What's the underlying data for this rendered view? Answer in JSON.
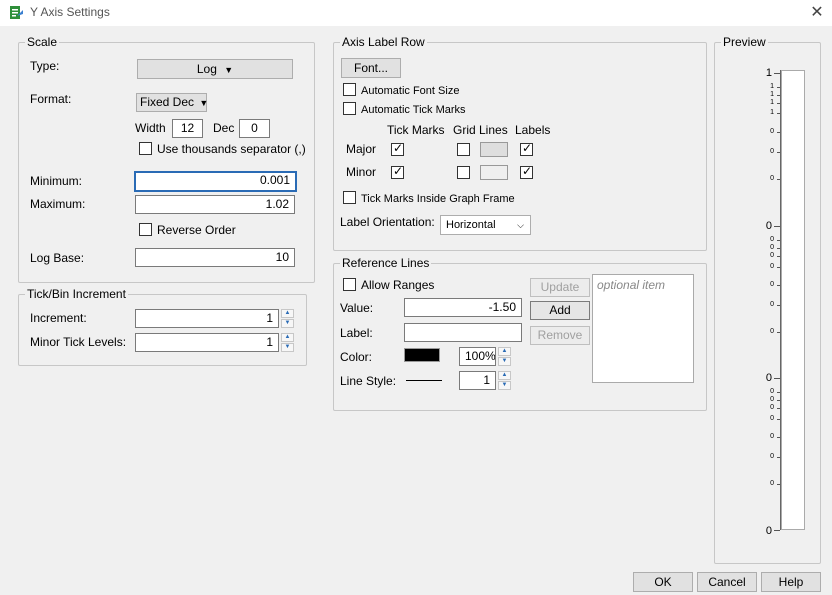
{
  "window": {
    "title": "Y Axis Settings"
  },
  "scale": {
    "legend": "Scale",
    "type_label": "Type:",
    "type_value": "Log",
    "format_label": "Format:",
    "format_value": "Fixed Dec",
    "width_label": "Width",
    "width_value": "12",
    "dec_label": "Dec",
    "dec_value": "0",
    "thousands_label": "Use thousands separator (,)",
    "thousands_checked": false,
    "minimum_label": "Minimum:",
    "minimum_value": "0.001",
    "maximum_label": "Maximum:",
    "maximum_value": "1.02",
    "reverse_label": "Reverse Order",
    "reverse_checked": false,
    "logbase_label": "Log Base:",
    "logbase_value": "10"
  },
  "tick": {
    "legend": "Tick/Bin Increment",
    "increment_label": "Increment:",
    "increment_value": "1",
    "minor_label": "Minor Tick Levels:",
    "minor_value": "1"
  },
  "axis_label_row": {
    "legend": "Axis Label Row",
    "font_button": "Font...",
    "auto_font_label": "Automatic Font Size",
    "auto_tick_label": "Automatic Tick Marks",
    "col_tick": "Tick Marks",
    "col_grid": "Grid Lines",
    "col_labels": "Labels",
    "major_label": "Major",
    "minor_label": "Minor",
    "inside_label": "Tick Marks Inside Graph Frame",
    "orientation_label": "Label Orientation:",
    "orientation_value": "Horizontal",
    "check_mark": "✓"
  },
  "reference_lines": {
    "legend": "Reference Lines",
    "allow_ranges_label": "Allow Ranges",
    "value_label": "Value:",
    "value_value": "-1.50",
    "label_label": "Label:",
    "label_value": "",
    "color_label": "Color:",
    "color_hex": "#000000",
    "opacity_value": "100%",
    "linestyle_label": "Line Style:",
    "linewidth_value": "1",
    "update_button": "Update",
    "add_button": "Add",
    "remove_button": "Remove",
    "list_placeholder": "optional item"
  },
  "preview": {
    "legend": "Preview",
    "top_label": "1",
    "upper_labels": [
      "1",
      "1",
      "1",
      "1",
      "0",
      "0",
      "0"
    ],
    "mid_label": "0",
    "mid_labels": [
      "0",
      "0",
      "0",
      "0",
      "0",
      "0",
      "0"
    ],
    "lower_label": "0",
    "lower_labels": [
      "0",
      "0",
      "0",
      "0",
      "0",
      "0",
      "0"
    ],
    "bottom_label": "0"
  },
  "footer": {
    "ok": "OK",
    "cancel": "Cancel",
    "help": "Help"
  }
}
